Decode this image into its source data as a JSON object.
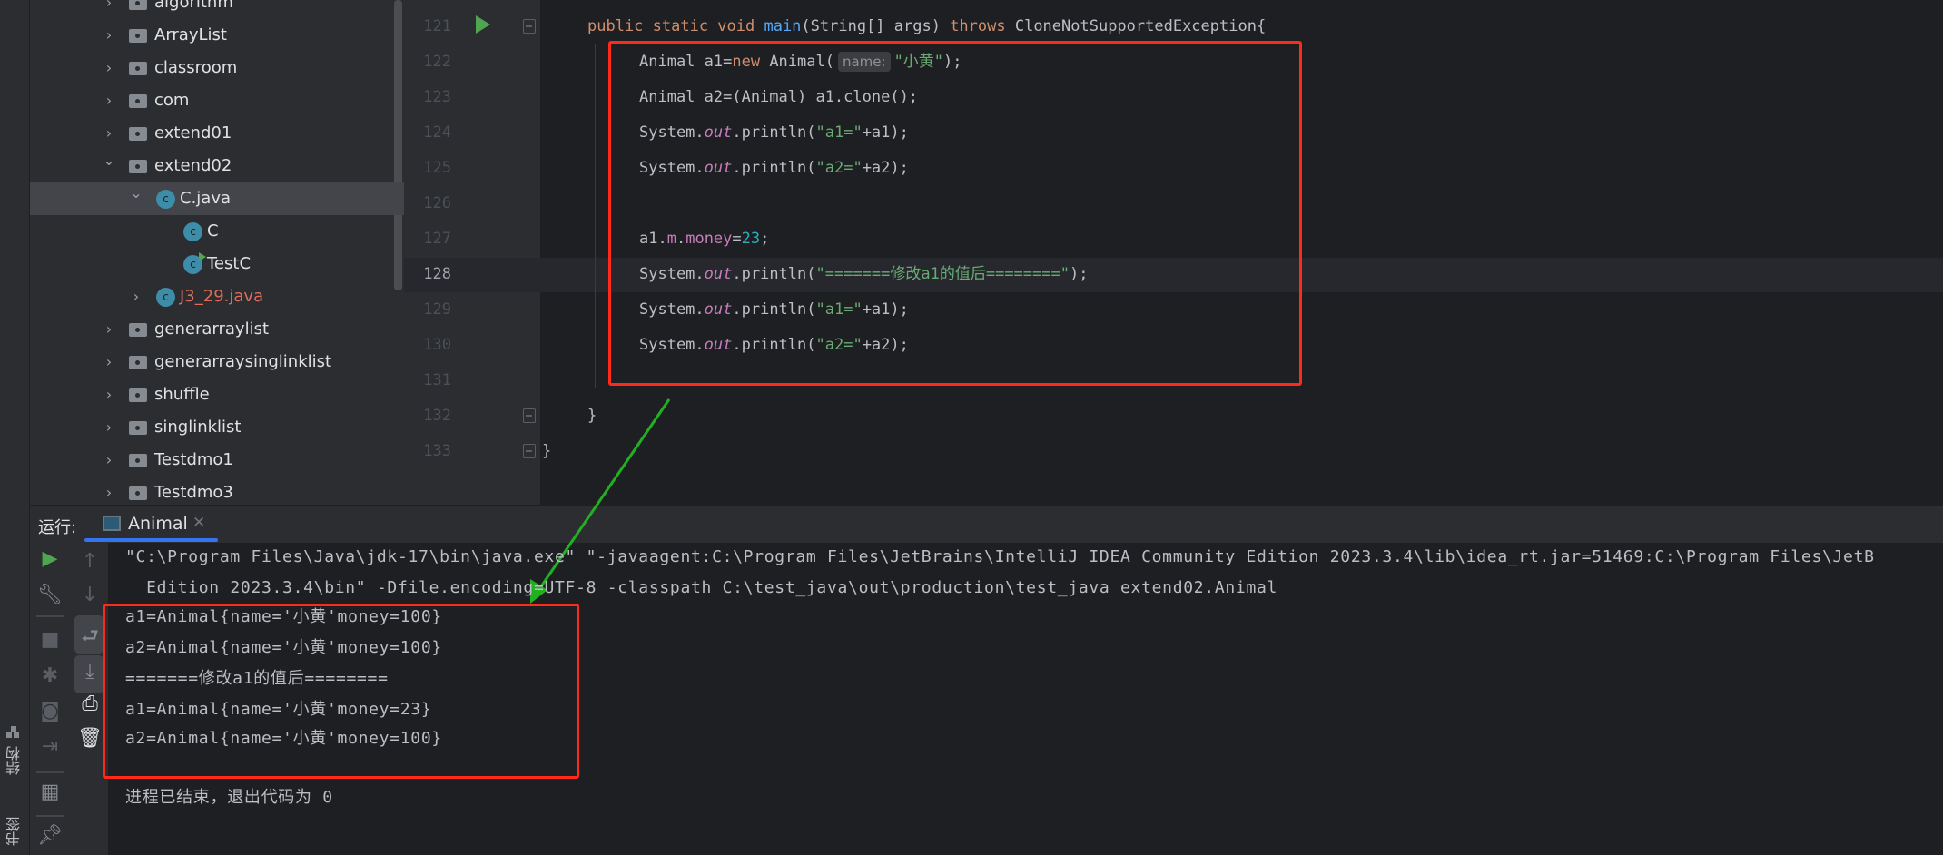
{
  "left_strip": {
    "structure_label": "结构",
    "bookmarks_label": "书签"
  },
  "project_tree": [
    {
      "level": 0,
      "expanded": false,
      "icon": "folder",
      "label": "algorithm"
    },
    {
      "level": 0,
      "expanded": false,
      "icon": "folder",
      "label": "ArrayList"
    },
    {
      "level": 0,
      "expanded": false,
      "icon": "folder",
      "label": "classroom"
    },
    {
      "level": 0,
      "expanded": false,
      "icon": "folder",
      "label": "com"
    },
    {
      "level": 0,
      "expanded": false,
      "icon": "folder",
      "label": "extend01"
    },
    {
      "level": 0,
      "expanded": true,
      "icon": "folder",
      "label": "extend02"
    },
    {
      "level": 1,
      "expanded": true,
      "icon": "class",
      "label": "C.java",
      "selected": true
    },
    {
      "level": 2,
      "icon": "class",
      "label": "C"
    },
    {
      "level": 2,
      "icon": "class-runnable",
      "label": "TestC"
    },
    {
      "level": 1,
      "expanded": false,
      "icon": "class",
      "label": "J3_29.java",
      "color": "#e06c5a"
    },
    {
      "level": 0,
      "expanded": false,
      "icon": "folder",
      "label": "generarraylist"
    },
    {
      "level": 0,
      "expanded": false,
      "icon": "folder",
      "label": "generarraysinglinklist"
    },
    {
      "level": 0,
      "expanded": false,
      "icon": "folder",
      "label": "shuffle"
    },
    {
      "level": 0,
      "expanded": false,
      "icon": "folder",
      "label": "singlinklist"
    },
    {
      "level": 0,
      "expanded": false,
      "icon": "folder",
      "label": "Testdmo1"
    },
    {
      "level": 0,
      "expanded": false,
      "icon": "folder",
      "label": "Testdmo3"
    }
  ],
  "editor": {
    "current_line": "128",
    "colors": {
      "keyword": "#cf8e6d",
      "method": "#56a8f5",
      "string": "#6aab73",
      "field": "#c77dbb",
      "number": "#2aacb8",
      "text": "#bcbec4"
    },
    "lines": [
      {
        "num": "121",
        "run": true,
        "fold": true,
        "indent": 0,
        "tokens": [
          {
            "t": "public static void ",
            "c": "keyword"
          },
          {
            "t": "main",
            "c": "method"
          },
          {
            "t": "(String[] args) ",
            "c": "text"
          },
          {
            "t": "throws ",
            "c": "keyword"
          },
          {
            "t": "CloneNotSupportedException{",
            "c": "text"
          }
        ]
      },
      {
        "num": "122",
        "indent": 1,
        "tokens": [
          {
            "t": "Animal a1=",
            "c": "text"
          },
          {
            "t": "new ",
            "c": "keyword"
          },
          {
            "t": "Animal(",
            "c": "text"
          },
          {
            "t": "name:",
            "c": "hint"
          },
          {
            "t": "\"小黄\"",
            "c": "string"
          },
          {
            "t": ");",
            "c": "text"
          }
        ]
      },
      {
        "num": "123",
        "indent": 1,
        "tokens": [
          {
            "t": "Animal a2=(Animal) a1.clone();",
            "c": "text"
          }
        ]
      },
      {
        "num": "124",
        "indent": 1,
        "tokens": [
          {
            "t": "System.",
            "c": "text"
          },
          {
            "t": "out",
            "c": "field-italic"
          },
          {
            "t": ".println(",
            "c": "text"
          },
          {
            "t": "\"a1=\"",
            "c": "string"
          },
          {
            "t": "+a1);",
            "c": "text"
          }
        ]
      },
      {
        "num": "125",
        "indent": 1,
        "tokens": [
          {
            "t": "System.",
            "c": "text"
          },
          {
            "t": "out",
            "c": "field-italic"
          },
          {
            "t": ".println(",
            "c": "text"
          },
          {
            "t": "\"a2=\"",
            "c": "string"
          },
          {
            "t": "+a2);",
            "c": "text"
          }
        ]
      },
      {
        "num": "126",
        "indent": 1,
        "tokens": []
      },
      {
        "num": "127",
        "indent": 1,
        "tokens": [
          {
            "t": "a1.",
            "c": "text"
          },
          {
            "t": "m",
            "c": "field"
          },
          {
            "t": ".",
            "c": "text"
          },
          {
            "t": "money",
            "c": "field"
          },
          {
            "t": "=",
            "c": "text"
          },
          {
            "t": "23",
            "c": "number"
          },
          {
            "t": ";",
            "c": "text"
          }
        ]
      },
      {
        "num": "128",
        "indent": 1,
        "tokens": [
          {
            "t": "System.",
            "c": "text"
          },
          {
            "t": "out",
            "c": "field-italic"
          },
          {
            "t": ".println(",
            "c": "text"
          },
          {
            "t": "\"=======修改a1的值后========\"",
            "c": "string"
          },
          {
            "t": ");",
            "c": "text"
          }
        ]
      },
      {
        "num": "129",
        "indent": 1,
        "tokens": [
          {
            "t": "System.",
            "c": "text"
          },
          {
            "t": "out",
            "c": "field-italic"
          },
          {
            "t": ".println(",
            "c": "text"
          },
          {
            "t": "\"a1=\"",
            "c": "string"
          },
          {
            "t": "+a1);",
            "c": "text"
          }
        ]
      },
      {
        "num": "130",
        "indent": 1,
        "tokens": [
          {
            "t": "System.",
            "c": "text"
          },
          {
            "t": "out",
            "c": "field-italic"
          },
          {
            "t": ".println(",
            "c": "text"
          },
          {
            "t": "\"a2=\"",
            "c": "string"
          },
          {
            "t": "+a2);",
            "c": "text"
          }
        ]
      },
      {
        "num": "131",
        "indent": 1,
        "tokens": []
      },
      {
        "num": "132",
        "fold": true,
        "indent": 0,
        "tokens": [
          {
            "t": "}",
            "c": "text"
          }
        ]
      },
      {
        "num": "133",
        "fold": true,
        "indent": -1,
        "tokens": [
          {
            "t": "}",
            "c": "text"
          }
        ]
      }
    ]
  },
  "run_panel": {
    "label": "运行:",
    "tab": "Animal",
    "console": [
      "\"C:\\Program Files\\Java\\jdk-17\\bin\\java.exe\" \"-javaagent:C:\\Program Files\\JetBrains\\IntelliJ IDEA Community Edition 2023.3.4\\lib\\idea_rt.jar=51469:C:\\Program Files\\JetB",
      "  Edition 2023.3.4\\bin\" -Dfile.encoding=UTF-8 -classpath C:\\test_java\\out\\production\\test_java extend02.Animal",
      "a1=Animal{name='小黄'money=100}",
      "a2=Animal{name='小黄'money=100}",
      "=======修改a1的值后========",
      "a1=Animal{name='小黄'money=23}",
      "a2=Animal{name='小黄'money=100}",
      "",
      "进程已结束，退出代码为 0"
    ]
  },
  "annotations": {
    "box_color": "#ff2a1a",
    "arrow_color": "#22b022"
  }
}
